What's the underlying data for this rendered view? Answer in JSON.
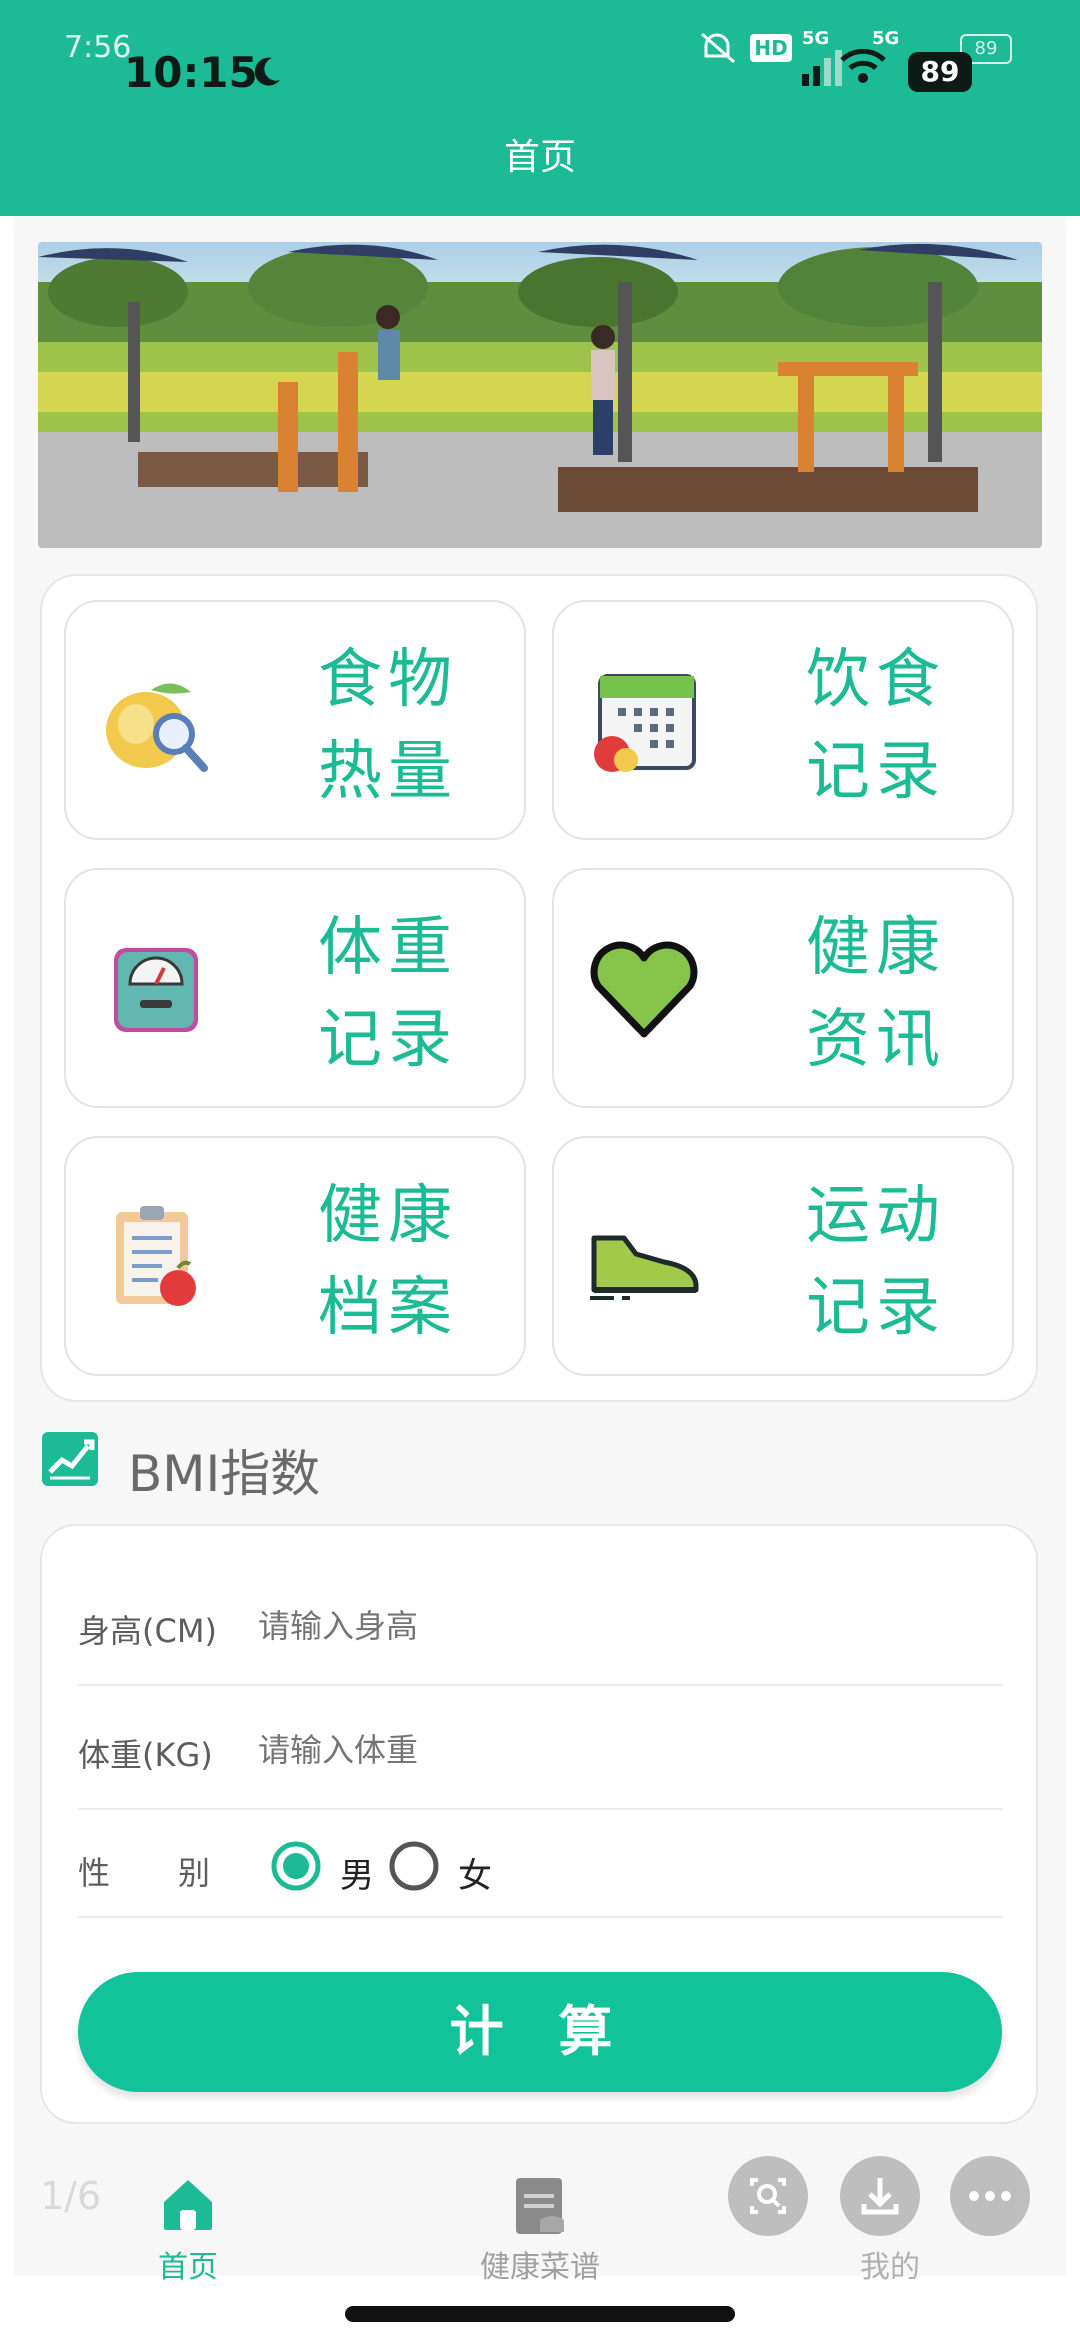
{
  "status_bar": {
    "time_back": "7:56",
    "time": "10:15",
    "battery_back": "89",
    "battery": "89",
    "network_a": "5G",
    "network_b": "5G",
    "hd": "HD"
  },
  "header": {
    "title": "首页"
  },
  "grid": {
    "tiles": [
      {
        "line1": "食物",
        "line2": "热量",
        "icon": "food-calorie-icon"
      },
      {
        "line1": "饮食",
        "line2": "记录",
        "icon": "diet-calendar-icon"
      },
      {
        "line1": "体重",
        "line2": "记录",
        "icon": "weight-scale-icon"
      },
      {
        "line1": "健康",
        "line2": "资讯",
        "icon": "heart-icon"
      },
      {
        "line1": "健康",
        "line2": "档案",
        "icon": "health-clipboard-icon"
      },
      {
        "line1": "运动",
        "line2": "记录",
        "icon": "sneaker-icon"
      }
    ]
  },
  "bmi": {
    "title": "BMI指数",
    "height_label": "身高(CM)",
    "height_placeholder": "请输入身高",
    "weight_label": "体重(KG)",
    "weight_placeholder": "请输入体重",
    "gender_label_a": "性",
    "gender_label_b": "别",
    "male": "男",
    "female": "女",
    "selected_gender": "男",
    "calc_button": "计 算"
  },
  "tabbar": {
    "page_counter": "1/6",
    "items": [
      {
        "label": "首页",
        "active": true
      },
      {
        "label": "健康菜谱",
        "active": false
      },
      {
        "label": "我的",
        "active": false
      }
    ]
  },
  "colors": {
    "accent": "#1dbb95",
    "button": "#12c39a"
  }
}
